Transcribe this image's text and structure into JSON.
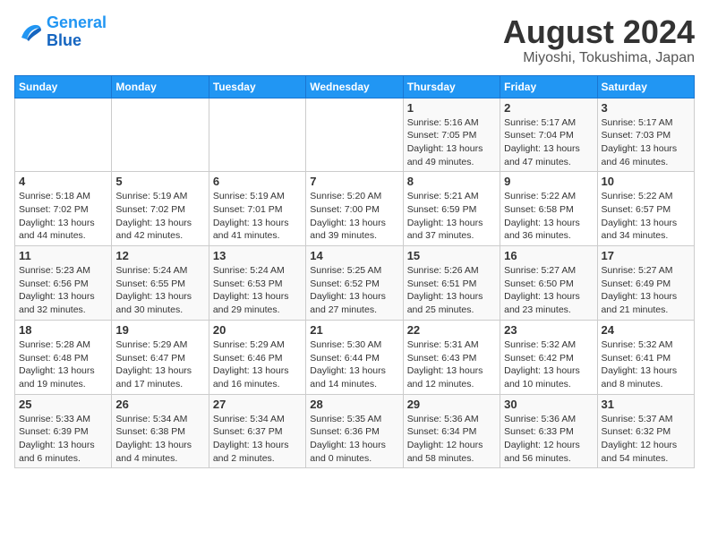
{
  "logo": {
    "line1": "General",
    "line2": "Blue"
  },
  "title": "August 2024",
  "subtitle": "Miyoshi, Tokushima, Japan",
  "weekdays": [
    "Sunday",
    "Monday",
    "Tuesday",
    "Wednesday",
    "Thursday",
    "Friday",
    "Saturday"
  ],
  "weeks": [
    [
      {
        "day": "",
        "info": ""
      },
      {
        "day": "",
        "info": ""
      },
      {
        "day": "",
        "info": ""
      },
      {
        "day": "",
        "info": ""
      },
      {
        "day": "1",
        "info": "Sunrise: 5:16 AM\nSunset: 7:05 PM\nDaylight: 13 hours\nand 49 minutes."
      },
      {
        "day": "2",
        "info": "Sunrise: 5:17 AM\nSunset: 7:04 PM\nDaylight: 13 hours\nand 47 minutes."
      },
      {
        "day": "3",
        "info": "Sunrise: 5:17 AM\nSunset: 7:03 PM\nDaylight: 13 hours\nand 46 minutes."
      }
    ],
    [
      {
        "day": "4",
        "info": "Sunrise: 5:18 AM\nSunset: 7:02 PM\nDaylight: 13 hours\nand 44 minutes."
      },
      {
        "day": "5",
        "info": "Sunrise: 5:19 AM\nSunset: 7:02 PM\nDaylight: 13 hours\nand 42 minutes."
      },
      {
        "day": "6",
        "info": "Sunrise: 5:19 AM\nSunset: 7:01 PM\nDaylight: 13 hours\nand 41 minutes."
      },
      {
        "day": "7",
        "info": "Sunrise: 5:20 AM\nSunset: 7:00 PM\nDaylight: 13 hours\nand 39 minutes."
      },
      {
        "day": "8",
        "info": "Sunrise: 5:21 AM\nSunset: 6:59 PM\nDaylight: 13 hours\nand 37 minutes."
      },
      {
        "day": "9",
        "info": "Sunrise: 5:22 AM\nSunset: 6:58 PM\nDaylight: 13 hours\nand 36 minutes."
      },
      {
        "day": "10",
        "info": "Sunrise: 5:22 AM\nSunset: 6:57 PM\nDaylight: 13 hours\nand 34 minutes."
      }
    ],
    [
      {
        "day": "11",
        "info": "Sunrise: 5:23 AM\nSunset: 6:56 PM\nDaylight: 13 hours\nand 32 minutes."
      },
      {
        "day": "12",
        "info": "Sunrise: 5:24 AM\nSunset: 6:55 PM\nDaylight: 13 hours\nand 30 minutes."
      },
      {
        "day": "13",
        "info": "Sunrise: 5:24 AM\nSunset: 6:53 PM\nDaylight: 13 hours\nand 29 minutes."
      },
      {
        "day": "14",
        "info": "Sunrise: 5:25 AM\nSunset: 6:52 PM\nDaylight: 13 hours\nand 27 minutes."
      },
      {
        "day": "15",
        "info": "Sunrise: 5:26 AM\nSunset: 6:51 PM\nDaylight: 13 hours\nand 25 minutes."
      },
      {
        "day": "16",
        "info": "Sunrise: 5:27 AM\nSunset: 6:50 PM\nDaylight: 13 hours\nand 23 minutes."
      },
      {
        "day": "17",
        "info": "Sunrise: 5:27 AM\nSunset: 6:49 PM\nDaylight: 13 hours\nand 21 minutes."
      }
    ],
    [
      {
        "day": "18",
        "info": "Sunrise: 5:28 AM\nSunset: 6:48 PM\nDaylight: 13 hours\nand 19 minutes."
      },
      {
        "day": "19",
        "info": "Sunrise: 5:29 AM\nSunset: 6:47 PM\nDaylight: 13 hours\nand 17 minutes."
      },
      {
        "day": "20",
        "info": "Sunrise: 5:29 AM\nSunset: 6:46 PM\nDaylight: 13 hours\nand 16 minutes."
      },
      {
        "day": "21",
        "info": "Sunrise: 5:30 AM\nSunset: 6:44 PM\nDaylight: 13 hours\nand 14 minutes."
      },
      {
        "day": "22",
        "info": "Sunrise: 5:31 AM\nSunset: 6:43 PM\nDaylight: 13 hours\nand 12 minutes."
      },
      {
        "day": "23",
        "info": "Sunrise: 5:32 AM\nSunset: 6:42 PM\nDaylight: 13 hours\nand 10 minutes."
      },
      {
        "day": "24",
        "info": "Sunrise: 5:32 AM\nSunset: 6:41 PM\nDaylight: 13 hours\nand 8 minutes."
      }
    ],
    [
      {
        "day": "25",
        "info": "Sunrise: 5:33 AM\nSunset: 6:39 PM\nDaylight: 13 hours\nand 6 minutes."
      },
      {
        "day": "26",
        "info": "Sunrise: 5:34 AM\nSunset: 6:38 PM\nDaylight: 13 hours\nand 4 minutes."
      },
      {
        "day": "27",
        "info": "Sunrise: 5:34 AM\nSunset: 6:37 PM\nDaylight: 13 hours\nand 2 minutes."
      },
      {
        "day": "28",
        "info": "Sunrise: 5:35 AM\nSunset: 6:36 PM\nDaylight: 13 hours\nand 0 minutes."
      },
      {
        "day": "29",
        "info": "Sunrise: 5:36 AM\nSunset: 6:34 PM\nDaylight: 12 hours\nand 58 minutes."
      },
      {
        "day": "30",
        "info": "Sunrise: 5:36 AM\nSunset: 6:33 PM\nDaylight: 12 hours\nand 56 minutes."
      },
      {
        "day": "31",
        "info": "Sunrise: 5:37 AM\nSunset: 6:32 PM\nDaylight: 12 hours\nand 54 minutes."
      }
    ]
  ]
}
